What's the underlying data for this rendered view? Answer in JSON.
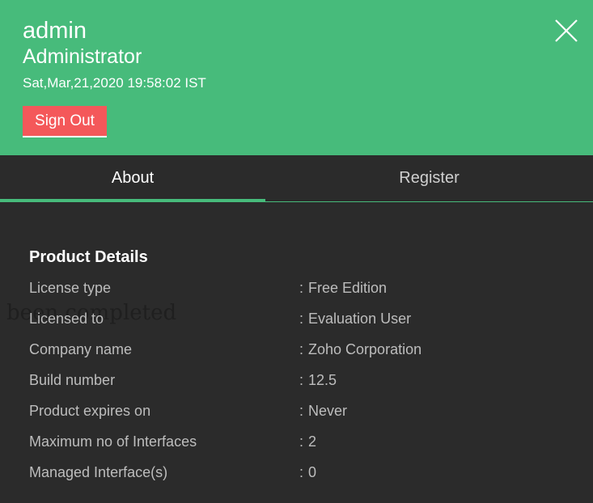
{
  "header": {
    "user_name": "admin",
    "user_role": "Administrator",
    "timestamp": "Sat,Mar,21,2020 19:58:02 IST",
    "sign_out_label": "Sign Out",
    "close_icon": "close-icon"
  },
  "tabs": [
    {
      "label": "About",
      "active": true
    },
    {
      "label": "Register",
      "active": false
    }
  ],
  "product_details": {
    "title": "Product Details",
    "separator": ":",
    "rows": [
      {
        "label": "License type",
        "value": "Free Edition"
      },
      {
        "label": "Licensed to",
        "value": "Evaluation User"
      },
      {
        "label": "Company name",
        "value": "Zoho Corporation"
      },
      {
        "label": "Build number",
        "value": "12.5"
      },
      {
        "label": "Product expires on",
        "value": "Never"
      },
      {
        "label": "Maximum no of Interfaces",
        "value": "2"
      },
      {
        "label": "Managed Interface(s)",
        "value": "0"
      }
    ]
  },
  "background_text": "been completed",
  "colors": {
    "header_bg": "#47bb7b",
    "sign_out_bg": "#f4585a",
    "panel_bg": "#2b2b2b",
    "accent": "#47bb7b"
  }
}
